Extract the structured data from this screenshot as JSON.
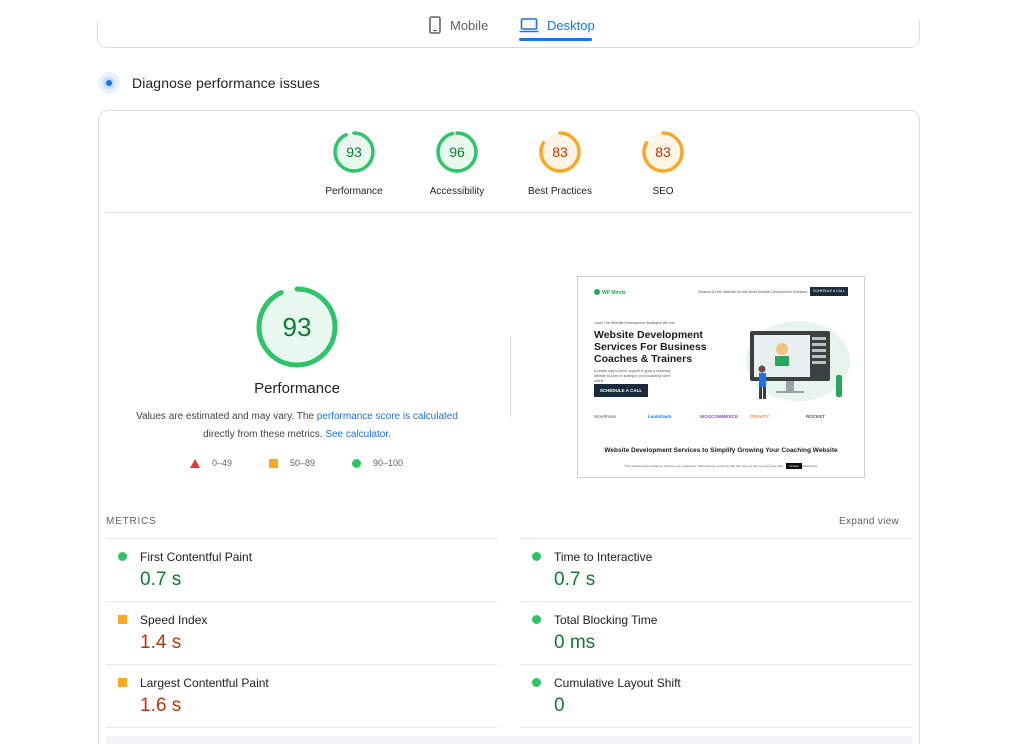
{
  "tabs": {
    "mobile_label": "Mobile",
    "desktop_label": "Desktop"
  },
  "section": {
    "title": "Diagnose performance issues"
  },
  "gauges": [
    {
      "score": "93",
      "label": "Performance",
      "status": "green"
    },
    {
      "score": "96",
      "label": "Accessibility",
      "status": "green"
    },
    {
      "score": "83",
      "label": "Best Practices",
      "status": "orange"
    },
    {
      "score": "83",
      "label": "SEO",
      "status": "orange"
    }
  ],
  "main_gauge": {
    "score": "93",
    "title": "Performance",
    "note_prefix": "Values are estimated and may vary. The ",
    "note_link": "performance score is calculated",
    "note_middle": " directly from these metrics. ",
    "note_link2": "See calculator."
  },
  "legend": {
    "fail": "0–49",
    "average": "50–89",
    "pass": "90–100"
  },
  "colors": {
    "pass": "#0c7c2f",
    "average": "#c33300",
    "accent": "#1a73e8",
    "pass_ring": "#2fc36a",
    "average_ring": "#f9a825",
    "fail": "#e53935"
  },
  "screenshot": {
    "logo": "WP Minds",
    "nav_links": "Request A Free Website Growth Audit    Website Development Solutions",
    "nav_cta": "SCHEDULE A CALL",
    "kicker": "Learn The Website Development Strategies We Use",
    "headline": "Website Development Services For Business Coaches & Trainers",
    "paragraph": "A simple way to build, support & grow a coaching website is a key to scaling in your coaching niche online.",
    "button": "SCHEDULE A CALL",
    "logos": [
      "WordPress",
      "LearnDash",
      "WOOCOMMERCE",
      "GRAVITY",
      "ROCKET"
    ],
    "subheadline": "Website Development Services to Simplify Growing Your Coaching Website",
    "footer_text": "This website uses cookies to improve your experience. We'll assume you're ok with this, but you can opt-out if you wish.",
    "footer_button": "Accept",
    "footer_link": "Read More"
  },
  "metrics": {
    "label": "METRICS",
    "expand_label": "Expand view",
    "items": [
      {
        "name": "First Contentful Paint",
        "value": "0.7 s",
        "status": "green"
      },
      {
        "name": "Time to Interactive",
        "value": "0.7 s",
        "status": "green"
      },
      {
        "name": "Speed Index",
        "value": "1.4 s",
        "status": "orange"
      },
      {
        "name": "Total Blocking Time",
        "value": "0 ms",
        "status": "green"
      },
      {
        "name": "Largest Contentful Paint",
        "value": "1.6 s",
        "status": "orange"
      },
      {
        "name": "Cumulative Layout Shift",
        "value": "0",
        "status": "green"
      }
    ]
  }
}
